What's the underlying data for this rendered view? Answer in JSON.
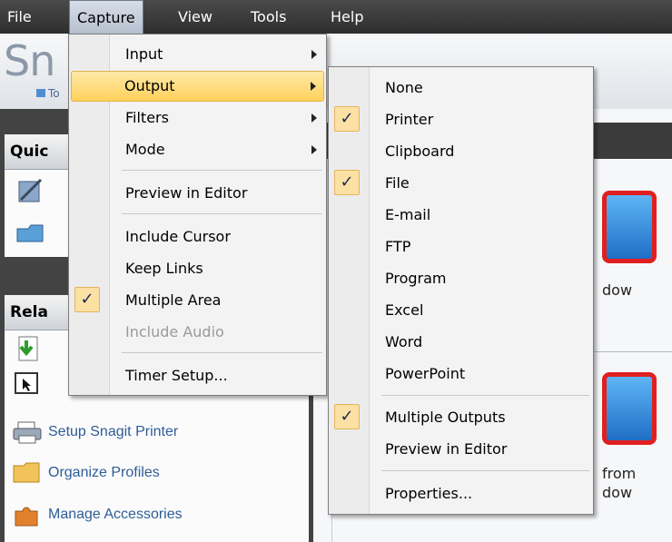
{
  "menubar": {
    "items": [
      "File",
      "Capture",
      "View",
      "Tools",
      "Help"
    ]
  },
  "brand": {
    "text": "Sn",
    "link": "To"
  },
  "left_panels": {
    "quick_title": "Quic",
    "related_title": "Rela",
    "related_items": [
      {
        "label": "Setup Snagit Printer",
        "icon": "printer-icon"
      },
      {
        "label": "Organize Profiles",
        "icon": "folder-icon"
      },
      {
        "label": "Manage Accessories",
        "icon": "puzzle-icon"
      }
    ]
  },
  "right_pane": {
    "texts": [
      "dow",
      "from",
      "dow"
    ]
  },
  "capture_menu": {
    "items": [
      {
        "label": "Input",
        "submenu": true,
        "checked": false,
        "disabled": false
      },
      {
        "label": "Output",
        "submenu": true,
        "checked": false,
        "disabled": false,
        "highlighted": true
      },
      {
        "label": "Filters",
        "submenu": true,
        "checked": false,
        "disabled": false
      },
      {
        "label": "Mode",
        "submenu": true,
        "checked": false,
        "disabled": false
      },
      {
        "label": "Preview in Editor",
        "submenu": false,
        "checked": false,
        "disabled": false
      },
      {
        "label": "Include Cursor",
        "submenu": false,
        "checked": false,
        "disabled": false
      },
      {
        "label": "Keep Links",
        "submenu": false,
        "checked": false,
        "disabled": false
      },
      {
        "label": "Multiple Area",
        "submenu": false,
        "checked": true,
        "disabled": false
      },
      {
        "label": "Include Audio",
        "submenu": false,
        "checked": false,
        "disabled": true
      },
      {
        "label": "Timer Setup...",
        "submenu": false,
        "checked": false,
        "disabled": false
      }
    ]
  },
  "output_menu": {
    "items": [
      {
        "label": "None",
        "checked": false
      },
      {
        "label": "Printer",
        "checked": true
      },
      {
        "label": "Clipboard",
        "checked": false
      },
      {
        "label": "File",
        "checked": true
      },
      {
        "label": "E-mail",
        "checked": false
      },
      {
        "label": "FTP",
        "checked": false
      },
      {
        "label": "Program",
        "checked": false
      },
      {
        "label": "Excel",
        "checked": false
      },
      {
        "label": "Word",
        "checked": false
      },
      {
        "label": "PowerPoint",
        "checked": false
      },
      {
        "label": "Multiple Outputs",
        "checked": true
      },
      {
        "label": "Preview in Editor",
        "checked": false
      },
      {
        "label": "Properties...",
        "checked": false
      }
    ]
  },
  "colors": {
    "highlight": "#ffd15a",
    "check_bg": "#fce1a5",
    "menubar": "#3a3a3a"
  }
}
